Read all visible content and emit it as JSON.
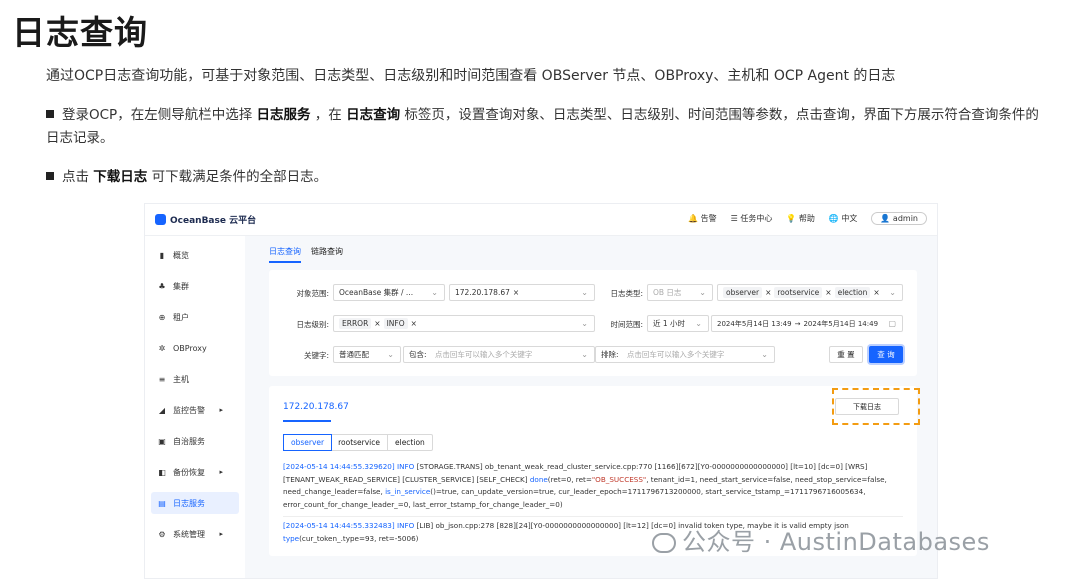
{
  "doc": {
    "title": "日志查询",
    "intro": "通过OCP日志查询功能，可基于对象范围、日志类型、日志级别和时间范围查看 OBServer 节点、OBProxy、主机和 OCP Agent 的日志",
    "b1_a": "登录OCP，在左侧导航栏中选择 ",
    "b1_b": "日志服务",
    "b1_c": " ，在 ",
    "b1_d": "日志查询",
    "b1_e": " 标签页，设置查询对象、日志类型、日志级别、时间范围等参数，点击查询，界面下方展示符合查询条件的日志记录。",
    "b2_a": "点击 ",
    "b2_b": "下载日志",
    "b2_c": " 可下载满足条件的全部日志。"
  },
  "app": {
    "brand": "OceanBase 云平台",
    "top": {
      "alert": "告警",
      "tasks": "任务中心",
      "help": "帮助",
      "lang": "中文",
      "user": "admin"
    },
    "sidebar": [
      "概览",
      "集群",
      "租户",
      "OBProxy",
      "主机",
      "监控告警",
      "自治服务",
      "备份恢复",
      "日志服务",
      "系统管理"
    ],
    "tabs": {
      "log": "日志查询",
      "trace": "链路查询"
    },
    "form": {
      "scope_label": "对象范围:",
      "scope_value": "OceanBase 集群 / ...",
      "host_tag": "172.20.178.67",
      "type_label": "日志类型:",
      "type_group": "OB 日志",
      "types": [
        "observer",
        "rootservice",
        "election"
      ],
      "level_label": "日志级别:",
      "levels": [
        "ERROR",
        "INFO"
      ],
      "time_label": "时间范围:",
      "time_preset": "近 1 小时",
      "time_start": "2024年5月14日 13:49",
      "time_end": "2024年5月14日 14:49",
      "kw_label": "关键字:",
      "kw_mode": "普通匹配",
      "include_label": "包含:",
      "include_ph": "点击回车可以输入多个关键字",
      "exclude_label": "排除:",
      "exclude_ph": "点击回车可以输入多个关键字",
      "reset": "重 置",
      "query": "查 询"
    },
    "result": {
      "host": "172.20.178.67",
      "download": "下载日志",
      "subtabs": [
        "observer",
        "rootservice",
        "election"
      ],
      "log1_time": "[2024-05-14 14:44:55.329620]",
      "log1_level": "INFO",
      "log1_text": "[STORAGE.TRANS] ob_tenant_weak_read_cluster_service.cpp:770 [1166][672][Y0-0000000000000000] [lt=10] [dc=0] [WRS]",
      "log1_line2a": "[TENANT_WEAK_READ_SERVICE] [CLUSTER_SERVICE] [SELF_CHECK] ",
      "log1_done": "done",
      "log1_line2b": "(ret=0, ret=",
      "log1_success": "\"OB_SUCCESS\"",
      "log1_line2c": ", tenant_id=1, need_start_service=false, need_stop_service=false,",
      "log1_line3a": "need_change_leader=false, ",
      "log1_inservice": "is_in_service",
      "log1_line3b": "()=true, can_update_version=true, cur_leader_epoch=1711796713200000, start_service_tstamp_=1711796716005634,",
      "log1_line4": "error_count_for_change_leader_=0, last_error_tstamp_for_change_leader_=0)",
      "log2_time": "[2024-05-14 14:44:55.332483]",
      "log2_level": "INFO",
      "log2_text": "[LIB] ob_json.cpp:278 [828][24][Y0-0000000000000000] [lt=12] [dc=0] invalid token type, maybe it is valid empty json",
      "log2_type": "type",
      "log2_rest": "(cur_token_.type=93, ret=-5006)"
    }
  },
  "watermark": "公众号 · AustinDatabases"
}
